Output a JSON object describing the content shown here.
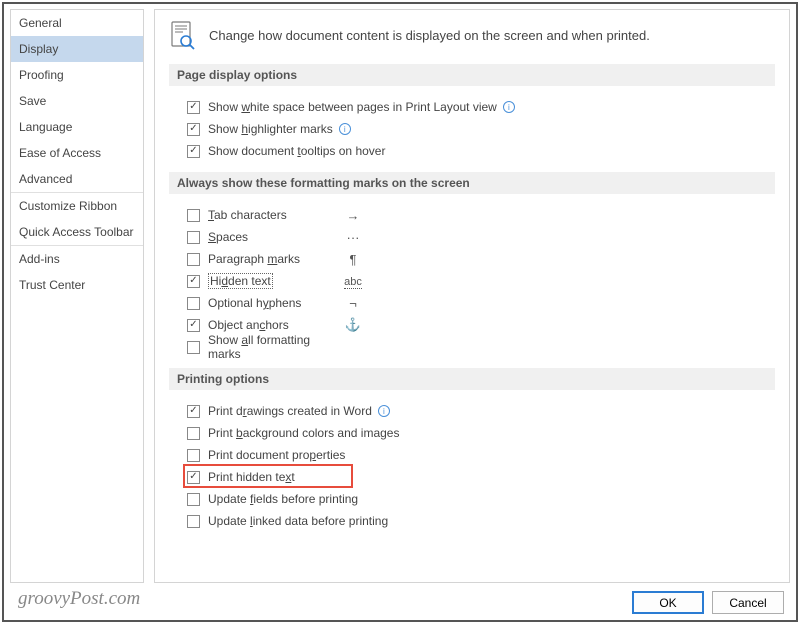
{
  "sidebar": {
    "items": [
      {
        "label": "General"
      },
      {
        "label": "Display"
      },
      {
        "label": "Proofing"
      },
      {
        "label": "Save"
      },
      {
        "label": "Language"
      },
      {
        "label": "Ease of Access"
      },
      {
        "label": "Advanced"
      },
      {
        "label": "Customize Ribbon"
      },
      {
        "label": "Quick Access Toolbar"
      },
      {
        "label": "Add-ins"
      },
      {
        "label": "Trust Center"
      }
    ],
    "selected": "Display"
  },
  "header": {
    "text": "Change how document content is displayed on the screen and when printed."
  },
  "section_page_display": {
    "title": "Page display options",
    "opts": [
      {
        "label_pre": "Show ",
        "ul": "w",
        "label_post": "hite space between pages in Print Layout view",
        "info": true
      },
      {
        "label_pre": "Show ",
        "ul": "h",
        "label_post": "ighlighter marks",
        "info": true
      },
      {
        "label_pre": "Show document ",
        "ul": "t",
        "label_post": "ooltips on hover",
        "info": false
      }
    ]
  },
  "section_formatting": {
    "title": "Always show these formatting marks on the screen",
    "opts": [
      {
        "ul": "T",
        "label_post": "ab characters",
        "symbol": "→",
        "checked": false
      },
      {
        "ul": "S",
        "label_post": "paces",
        "symbol": "···",
        "checked": false
      },
      {
        "label_pre": "Paragraph ",
        "ul": "m",
        "label_post": "arks",
        "symbol": "¶",
        "checked": false
      },
      {
        "label_pre": "Hi",
        "ul": "d",
        "label_post": "den text",
        "symbol": "abc",
        "checked": true,
        "focus": true,
        "abc": true
      },
      {
        "label_pre": "Optional h",
        "ul": "y",
        "label_post": "phens",
        "symbol": "¬",
        "checked": false
      },
      {
        "label_pre": "Object an",
        "ul": "c",
        "label_post": "hors",
        "symbol": "⚓",
        "checked": true,
        "anchor": true
      },
      {
        "label_pre": "Show ",
        "ul": "a",
        "label_post": "ll formatting marks",
        "symbol": "",
        "checked": false
      }
    ]
  },
  "section_printing": {
    "title": "Printing options",
    "opts": [
      {
        "label_pre": "Print d",
        "ul": "r",
        "label_post": "awings created in Word",
        "info": true,
        "checked": true
      },
      {
        "label_pre": "Print ",
        "ul": "b",
        "label_post": "ackground colors and images",
        "checked": false
      },
      {
        "label_pre": "Print document pro",
        "ul": "p",
        "label_post": "erties",
        "checked": false
      },
      {
        "label_pre": "Print hidden te",
        "ul": "x",
        "label_post": "t",
        "checked": true,
        "highlight": true
      },
      {
        "label_pre": "Update ",
        "ul": "f",
        "label_post": "ields before printing",
        "checked": false
      },
      {
        "label_pre": "Update ",
        "ul": "l",
        "label_post": "inked data before printing",
        "checked": false
      }
    ]
  },
  "buttons": {
    "ok": "OK",
    "cancel": "Cancel"
  },
  "watermark": "groovyPost.com"
}
